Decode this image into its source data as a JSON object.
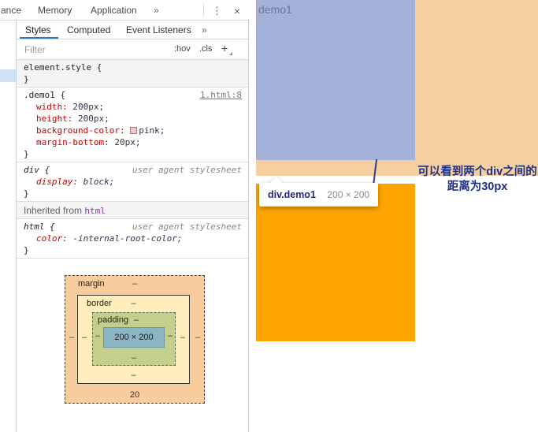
{
  "devtools_topbar": {
    "truncated_tab": "ance",
    "tab_memory": "Memory",
    "tab_application": "Application",
    "overflow": "»",
    "menu_icon": "⋮",
    "close_icon": "×"
  },
  "styles_pane": {
    "tab_styles": "Styles",
    "tab_computed": "Computed",
    "tab_event_listeners": "Event Listeners",
    "tabs_overflow": "»",
    "filter_placeholder": "Filter",
    "pseudo_button": ":hov",
    "class_button": ".cls",
    "new_rule_button": "+",
    "element_style": {
      "selector_line": "element.style {",
      "close_brace": "}"
    },
    "demo1_rule": {
      "selector_line": ".demo1 {",
      "source_link": "1.html:8",
      "close_brace": "}",
      "props": [
        {
          "name": "width:",
          "value": "200px;"
        },
        {
          "name": "height:",
          "value": "200px;"
        },
        {
          "name": "background-color:",
          "value": "pink;"
        },
        {
          "name": "margin-bottom:",
          "value": "20px;"
        }
      ]
    },
    "div_rule": {
      "selector_line": "div {",
      "note": "user agent stylesheet",
      "close_brace": "}",
      "props": [
        {
          "name": "display:",
          "value": "block;"
        }
      ]
    },
    "inherited": {
      "prefix": "Inherited from ",
      "node": "html"
    },
    "html_rule": {
      "selector_line": "html {",
      "note": "user agent stylesheet",
      "close_brace": "}",
      "props": [
        {
          "name": "color:",
          "value": "-internal-root-color;"
        }
      ]
    }
  },
  "box_model": {
    "margin_label": "margin",
    "border_label": "border",
    "padding_label": "padding",
    "content_size": "200 × 200",
    "margin_bottom_value": "20",
    "dash": "–"
  },
  "page": {
    "demo1_text": "demo1",
    "tooltip": {
      "selector": "div.demo1",
      "dimensions": "200 × 200"
    },
    "annotation": {
      "line1": "可以看到两个div之间的",
      "line2": "距离为30px"
    }
  },
  "colors": {
    "highlight_content": "#a4b1d8",
    "highlight_margin": "#f6cfa1",
    "demo2_background": "#ffa502",
    "annotation_text": "#1d3189",
    "swatch_pink": "#ffc0cb",
    "active_tab_underline": "#2e75b6"
  }
}
